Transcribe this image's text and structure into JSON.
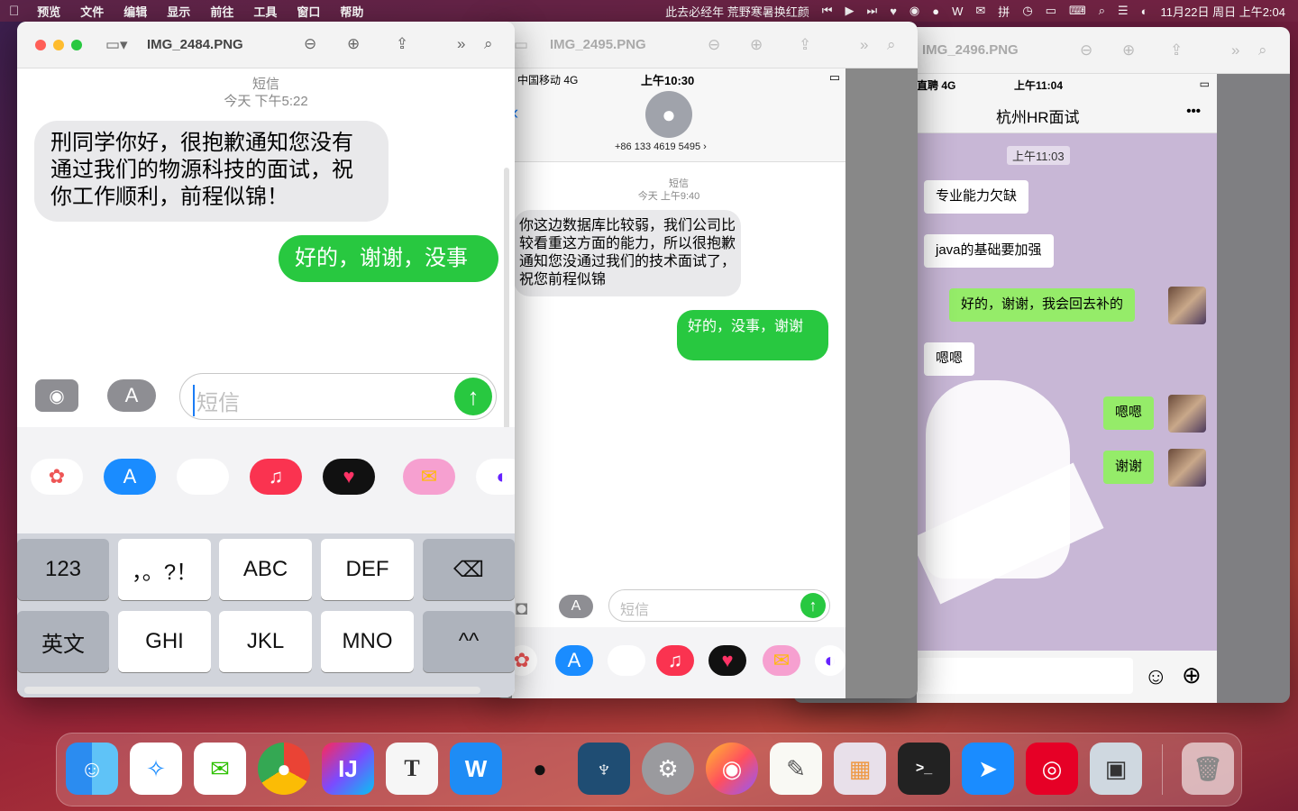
{
  "menubar": {
    "apple": "",
    "app": "预览",
    "items": [
      "文件",
      "编辑",
      "显示",
      "前往",
      "工具",
      "窗口",
      "帮助"
    ],
    "song": "此去必经年 荒野寒暑换红颜",
    "datetime": "11月22日 周日 上午2:04"
  },
  "w1": {
    "title": "IMG_2484.PNG",
    "header_label": "短信",
    "header_time": "今天 下午5:22",
    "msg_in": "刑同学你好，很抱歉通知您没有通过我们的物源科技的面试，祝你工作顺利，前程似锦！",
    "msg_out": "好的，谢谢，没事",
    "input_placeholder": "短信",
    "keys": [
      "123",
      "，。?！",
      "ABC",
      "DEF",
      "英文",
      "GHI",
      "JKL",
      "MNO",
      "^^"
    ]
  },
  "w2": {
    "title": "IMG_2495.PNG",
    "carrier": "中国移动  4G",
    "time": "上午10:30",
    "phone": "+86 133 4619 5495 ›",
    "header_label": "短信",
    "header_time": "今天 上午9:40",
    "msg_in": "你这边数据库比较弱，我们公司比较看重这方面的能力，所以很抱歉通知您没通过我们的技术面试了，祝您前程似锦",
    "msg_out": "好的，没事，谢谢",
    "input_placeholder": "短信"
  },
  "w3": {
    "title": "IMG_2496.PNG",
    "carrier": "直聘 4G",
    "time": "上午11:04",
    "chat_title": "杭州HR面试",
    "more": "•••",
    "timestamp": "上午11:03",
    "msgs": [
      "专业能力欠缺",
      "java的基础要加强",
      "好的，谢谢，我会回去补的",
      "嗯嗯",
      "嗯嗯",
      "谢谢"
    ]
  },
  "dock": {
    "items": [
      "Finder",
      "Safari",
      "WeChat",
      "Chrome",
      "IntelliJ IDEA",
      "Typora",
      "WPS",
      "QQ",
      "MySQL Workbench",
      "System Preferences",
      "Firefox",
      "TextEdit",
      "Launchpad",
      "Terminal",
      "DingTalk",
      "NetEase Music",
      "Preview",
      "Trash"
    ]
  }
}
